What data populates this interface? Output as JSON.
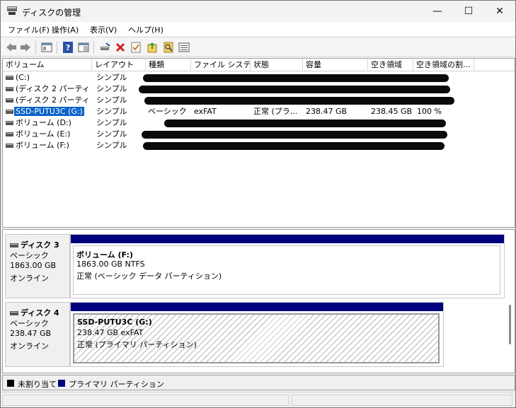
{
  "window": {
    "title": "ディスクの管理",
    "controls": {
      "minimize": "—",
      "maximize": "☐",
      "close": "✕"
    }
  },
  "menu": {
    "items": [
      "ファイル(F)",
      "操作(A)",
      "表示(V)",
      "ヘルプ(H)"
    ]
  },
  "toolbar": {
    "icons": [
      "back-arrow-icon",
      "forward-arrow-icon",
      "properties-panel-icon",
      "help-icon",
      "view-panel-icon",
      "connect-disk-icon",
      "delete-icon",
      "check-icon",
      "import-icon",
      "search-icon",
      "list-view-icon"
    ],
    "delete_color": "#d42020",
    "help_color": "#2b50a8"
  },
  "volume_list": {
    "headers": [
      "ボリューム",
      "レイアウト",
      "種類",
      "ファイル システム",
      "状態",
      "容量",
      "空き領域",
      "空き領域の割..."
    ],
    "rows": [
      {
        "volume": " (C:)",
        "layout": "シンプル",
        "redacted": true
      },
      {
        "volume": "(ディスク 2 パーティシ...",
        "layout": "シンプル",
        "redacted": true
      },
      {
        "volume": "(ディスク 2 パーティシ...",
        "layout": "シンプル",
        "redacted": true
      },
      {
        "volume": "SSD-PUTU3C (G:)",
        "layout": "シンプル",
        "type": "ベーシック",
        "fs": "exFAT",
        "status": "正常 (プラ...",
        "capacity": "238.47 GB",
        "free": "238.45 GB",
        "free_pct": "100 %",
        "selected": true,
        "redacted": false
      },
      {
        "volume": "ボリューム (D:)",
        "layout": "シンプル",
        "redacted": true
      },
      {
        "volume": "ボリューム (E:)",
        "layout": "シンプル",
        "redacted": true
      },
      {
        "volume": "ボリューム (F:)",
        "layout": "シンプル",
        "redacted": true
      }
    ]
  },
  "disks": [
    {
      "name": "ディスク 3",
      "type": "ベーシック",
      "size": "1863.00 GB",
      "state": "オンライン",
      "partition": {
        "name": "ボリューム  (F:)",
        "size_fs": "1863.00 GB NTFS",
        "status": "正常 (ベーシック データ パーティション)"
      }
    },
    {
      "name": "ディスク 4",
      "type": "ベーシック",
      "size": "238.47 GB",
      "state": "オンライン",
      "partition": {
        "name": "SSD-PUTU3C  (G:)",
        "size_fs": "238.47 GB exFAT",
        "status": "正常 (プライマリ パーティション)"
      }
    }
  ],
  "legend": {
    "items": [
      {
        "label": "未割り当て",
        "color": "#000000"
      },
      {
        "label": "プライマリ パーティション",
        "color": "#00007f"
      }
    ]
  },
  "colors": {
    "primary_partition": "#00007f",
    "selection": "#0a64c8"
  }
}
